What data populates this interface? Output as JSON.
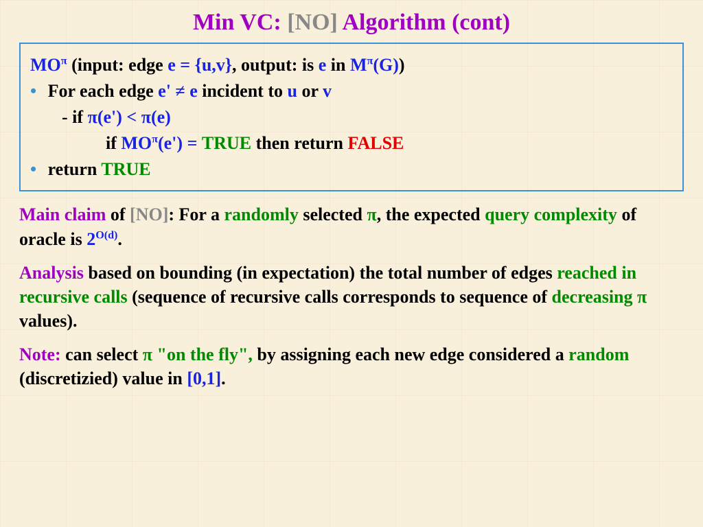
{
  "title": {
    "p1": "Min VC:",
    "p2": "[NO]",
    "p3": "Algorithm (cont)"
  },
  "box": {
    "l1": {
      "mo": "MO",
      "pi": "π",
      "input": " (input: edge ",
      "e_eq": "e = {u,v}",
      "out": ", output: is ",
      "e": "e",
      "in": " in ",
      "m": "M",
      "g": "(G)",
      "close": ")"
    },
    "l2": {
      "txt1": "For each edge ",
      "ep": "e' ",
      "neq": "≠",
      "e": " e",
      "txt2": " incident to ",
      "u": "u",
      "or": " or ",
      "v": "v"
    },
    "l3": {
      "dash": "- ",
      "if": "if ",
      "pi1": "π",
      "ep": "(e') < ",
      "pi2": "π",
      "e": "(e)"
    },
    "l4": {
      "if": "if ",
      "mo": "MO",
      "pi": "π",
      "ep": "(e') = ",
      "t": "TRUE",
      "then": " then return ",
      "f": "FALSE"
    },
    "l5": {
      "ret": "return ",
      "t": "TRUE"
    }
  },
  "p1": {
    "mc": "Main claim",
    "of": " of ",
    "no": "[NO]",
    "col": ": For a ",
    "rand": "randomly",
    "sel": " selected ",
    "pi": "π",
    "exp": ", the expected ",
    "qc": "query complexity",
    "oracle": " of oracle is ",
    "two": "2",
    "od": "O(d)",
    "dot": "."
  },
  "p2": {
    "an": "Analysis",
    "b1": " based on bounding (in expectation) the total number of edges ",
    "rr": "reached in recursive calls",
    "b2": " (sequence of recursive calls corresponds to sequence of ",
    "dec": "decreasing ",
    "pi": "π",
    "val": " values)."
  },
  "p3": {
    "note": "Note:",
    "can": " can select ",
    "pi": "π",
    "fly": " \"on the fly\",",
    "by": " by assigning each new edge considered a ",
    "rand": "random",
    "disc": " (discretizied) value in ",
    "rng": "[0,1]",
    "dot": "."
  }
}
